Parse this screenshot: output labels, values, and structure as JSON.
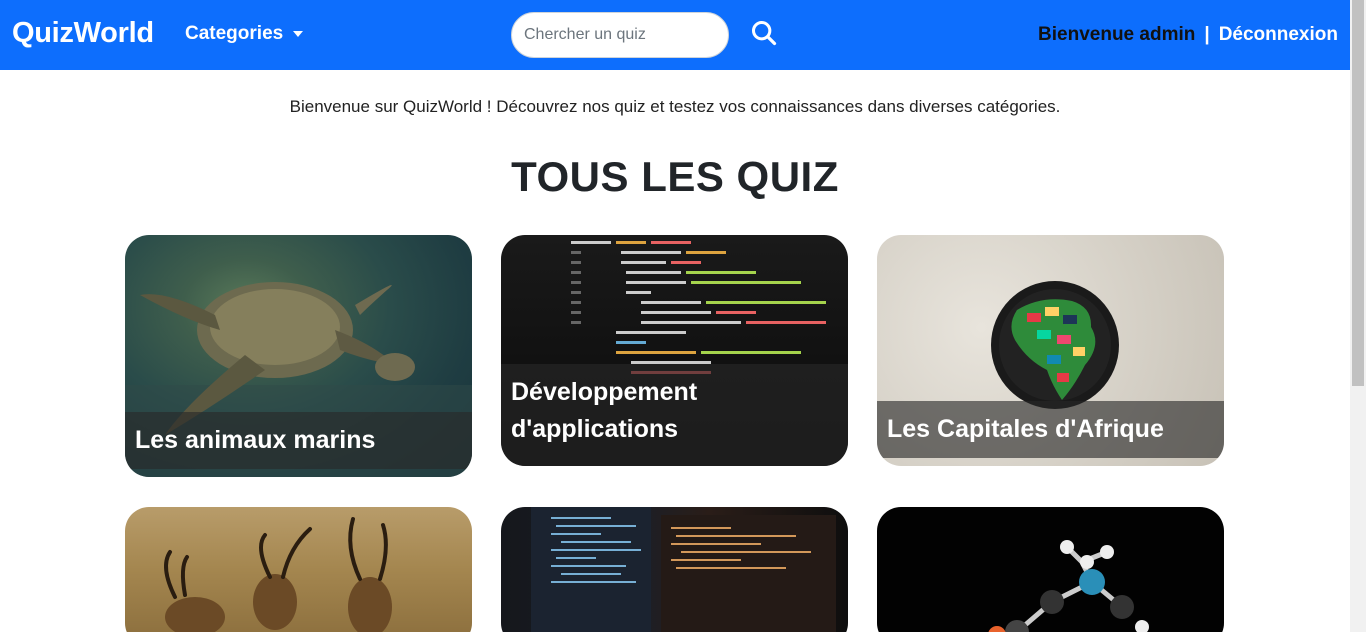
{
  "navbar": {
    "brand": "QuizWorld",
    "categories_label": "Categories",
    "search_placeholder": "Chercher un quiz",
    "search_value": "",
    "welcome": "Bienvenue admin",
    "separator": "|",
    "logout": "Déconnexion",
    "bg_color": "#0d6efd"
  },
  "main": {
    "intro": "Bienvenue sur QuizWorld ! Découvrez nos quiz et testez vos connaissances dans diverses catégories.",
    "heading": "TOUS LES QUIZ"
  },
  "cards": [
    {
      "title": "Les animaux marins",
      "image": "sea-turtle"
    },
    {
      "title": "Développement d'applications",
      "image": "code-screen"
    },
    {
      "title": "Les Capitales d'Afrique",
      "image": "africa-flags-map"
    },
    {
      "title": "",
      "image": "antelopes"
    },
    {
      "title": "",
      "image": "code-monitors"
    },
    {
      "title": "",
      "image": "molecule"
    }
  ],
  "icons": {
    "search": "search-icon",
    "caret": "chevron-down-icon"
  }
}
